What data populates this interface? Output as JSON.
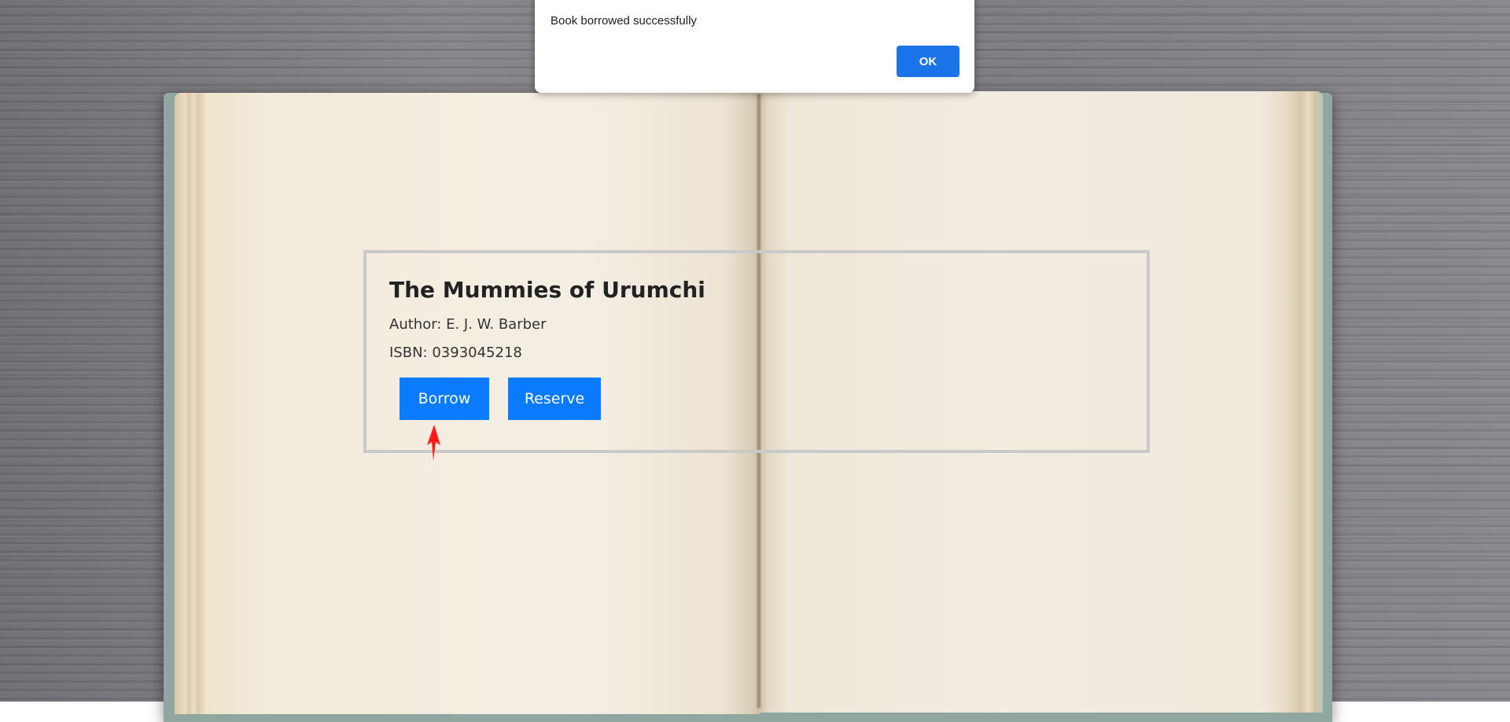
{
  "dialog": {
    "message": "Book borrowed successfully",
    "ok_label": "OK"
  },
  "book": {
    "title": "The Mummies of Urumchi",
    "author_line": "Author: E. J. W. Barber",
    "isbn_line": "ISBN: 0393045218"
  },
  "actions": {
    "borrow_label": "Borrow",
    "reserve_label": "Reserve"
  },
  "colors": {
    "action_button": "#0a7bff",
    "dialog_button": "#1a73e8",
    "cursor_arrow": "#ff1a1a"
  },
  "icons": {
    "cursor": "red-arrow-cursor-icon"
  }
}
